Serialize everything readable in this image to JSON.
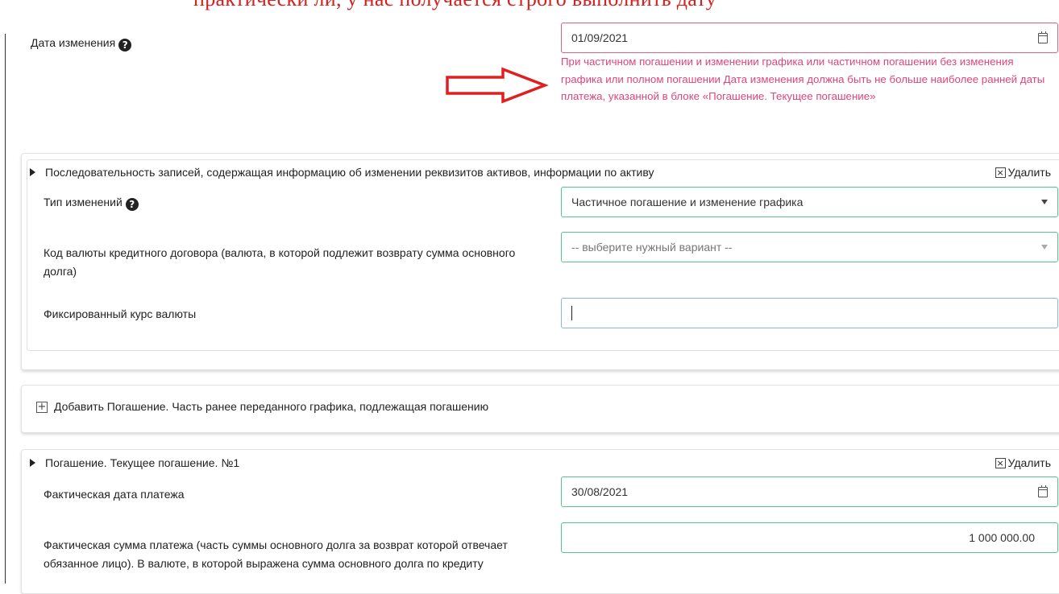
{
  "top_cut_text": "практически ли, у нас получается строго выполнить дату",
  "change_date": {
    "label": "Дата изменения",
    "help_icon": "question-circle-icon",
    "value": "01/09/2021",
    "error": "При частичном погашении и изменении графика или частичном погашении без изменения графика или полном погашении Дата изменения должна быть не больше наиболее ранней даты платежа, указанной в блоке «Погашение. Текущее погашение»"
  },
  "arrow_color": "#e02020",
  "section_changes": {
    "title": "Последовательность записей, содержащая информацию об изменении реквизитов активов, информации по активу",
    "delete_label": "Удалить",
    "change_type": {
      "label": "Тип изменений",
      "value": "Частичное погашение и изменение графика"
    },
    "currency_code": {
      "label": "Код валюты кредитного договора (валюта, в которой подлежит возврату сумма основного долга)",
      "placeholder": "-- выберите нужный вариант --"
    },
    "fixed_rate": {
      "label": "Фиксированный курс валюты",
      "value": ""
    }
  },
  "add_repayment": {
    "label": "Добавить Погашение. Часть ранее переданного графика, подлежащая погашению"
  },
  "section_repayment": {
    "title": "Погашение. Текущее погашение. №1",
    "delete_label": "Удалить",
    "actual_date": {
      "label": "Фактическая дата платежа",
      "value": "30/08/2021"
    },
    "actual_amount": {
      "label": "Фактическая сумма платежа (часть суммы основного долга за возврат которой отвечает обязанное лицо). В валюте, в которой выражена сумма основного долга по кредиту",
      "value": "1 000 000.00"
    }
  },
  "colors": {
    "error": "#e0447a",
    "valid_border": "#4fc88a",
    "focus_border": "#8ab4e8"
  }
}
